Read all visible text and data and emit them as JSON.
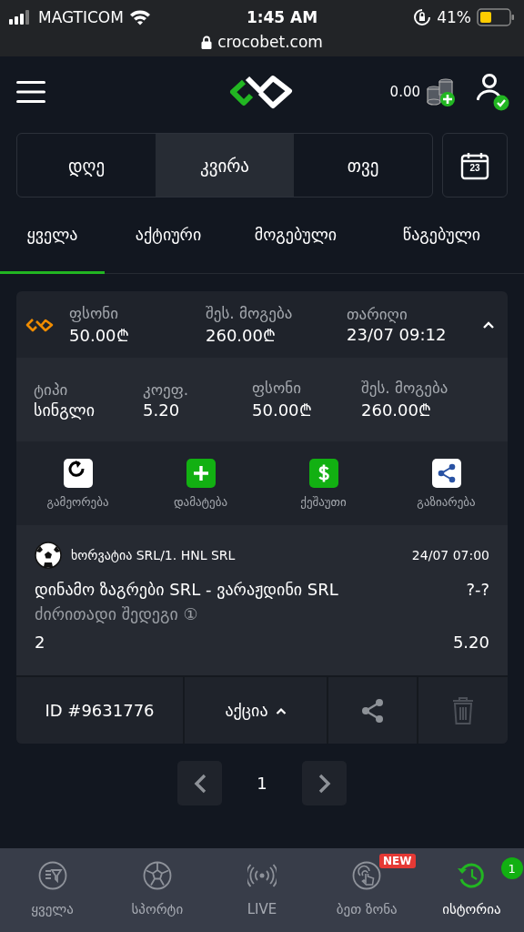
{
  "status_bar": {
    "carrier": "MAGTICOM",
    "time": "1:45 AM",
    "battery": "41%",
    "url": "crocobet.com"
  },
  "header": {
    "balance": "0.00",
    "logged_in": true
  },
  "period_tabs": [
    {
      "label": "დღე",
      "selected": false
    },
    {
      "label": "კვირა",
      "selected": true
    },
    {
      "label": "თვე",
      "selected": false
    }
  ],
  "calendar_day": "23",
  "filter_tabs": [
    {
      "label": "ყველა",
      "selected": true
    },
    {
      "label": "აქტიური",
      "selected": false
    },
    {
      "label": "მოგებული",
      "selected": false
    },
    {
      "label": "წაგებული",
      "selected": false
    }
  ],
  "bet": {
    "expanded": true,
    "summary": [
      {
        "label": "ფსონი",
        "value": "50.00₾"
      },
      {
        "label": "შეს. მოგება",
        "value": "260.00₾"
      },
      {
        "label": "თარიღი",
        "value": "23/07 09:12"
      }
    ],
    "details": [
      {
        "label": "ტიპი",
        "value": "სინგლი"
      },
      {
        "label": "კოეფ.",
        "value": "5.20"
      },
      {
        "label": "ფსონი",
        "value": "50.00₾"
      },
      {
        "label": "შეს. მოგება",
        "value": "260.00₾"
      }
    ],
    "actions": [
      {
        "kind": "repeat",
        "label": "გამეორება"
      },
      {
        "kind": "add",
        "label": "დამატება"
      },
      {
        "kind": "cashout",
        "label": "ქეშაუთი"
      },
      {
        "kind": "share",
        "label": "გაზიარება"
      }
    ],
    "event": {
      "league": "ხორვატია SRL/1. HNL SRL",
      "time": "24/07 07:00",
      "match": "დინამო ზაგრები SRL - ვარაჟდინი SRL",
      "score": "?-?",
      "market": "ძირითადი შედეგი ①",
      "pick": "2",
      "odds": "5.20"
    },
    "id": "ID #9631776",
    "promo": "აქცია"
  },
  "pagination": {
    "page": "1"
  },
  "bottom_nav": [
    {
      "kind": "all",
      "label": "ყველა",
      "selected": false
    },
    {
      "kind": "sports",
      "label": "სპორტი",
      "selected": false
    },
    {
      "kind": "live",
      "label": "LIVE",
      "selected": false
    },
    {
      "kind": "betzone",
      "label": "ბეთ ზონა",
      "selected": false,
      "badge": "NEW"
    },
    {
      "kind": "history",
      "label": "ისტორია",
      "selected": true,
      "count": "1"
    }
  ]
}
